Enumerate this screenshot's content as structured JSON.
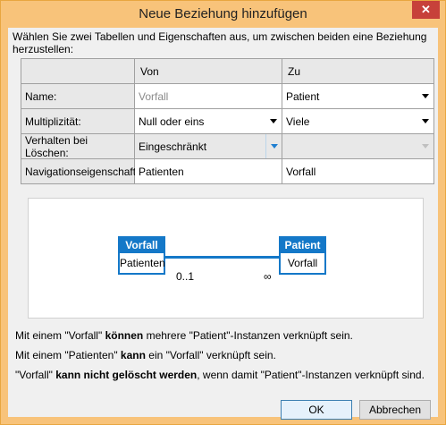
{
  "window": {
    "title": "Neue Beziehung hinzufügen",
    "close_glyph": "✕"
  },
  "intro": "Wählen Sie zwei Tabellen und Eigenschaften aus, um zwischen beiden eine Beziehung herzustellen:",
  "grid": {
    "col_from": "Von",
    "col_to": "Zu",
    "rows": [
      {
        "label": "Name:",
        "from": "Vorfall",
        "to": "Patient"
      },
      {
        "label": "Multiplizität:",
        "from": "Null oder eins",
        "to": "Viele"
      },
      {
        "label": "Verhalten bei Löschen:",
        "from": "Eingeschränkt",
        "to": ""
      },
      {
        "label": "Navigationseigenschaft:",
        "from": "Patienten",
        "to": "Vorfall"
      }
    ]
  },
  "diagram": {
    "left_entity": {
      "name": "Vorfall",
      "property": "Patienten"
    },
    "right_entity": {
      "name": "Patient",
      "property": "Vorfall"
    },
    "left_multiplicity": "0..1",
    "right_multiplicity": "∞"
  },
  "descriptions": {
    "line1": {
      "a": "Mit einem \"Vorfall\" ",
      "b": "können",
      "c": " mehrere \"Patient\"-Instanzen verknüpft sein."
    },
    "line2": {
      "a": "Mit einem \"Patienten\" ",
      "b": "kann",
      "c": " ein \"Vorfall\" verknüpft sein."
    },
    "line3": {
      "a": "\"Vorfall\" ",
      "b": "kann nicht gelöscht werden",
      "c": ", wenn damit \"Patient\"-Instanzen verknüpft sind."
    }
  },
  "buttons": {
    "ok": "OK",
    "cancel": "Abbrechen"
  },
  "colors": {
    "titlebar": "#f8c37a",
    "accent": "#1478c8",
    "close": "#c7413a"
  }
}
